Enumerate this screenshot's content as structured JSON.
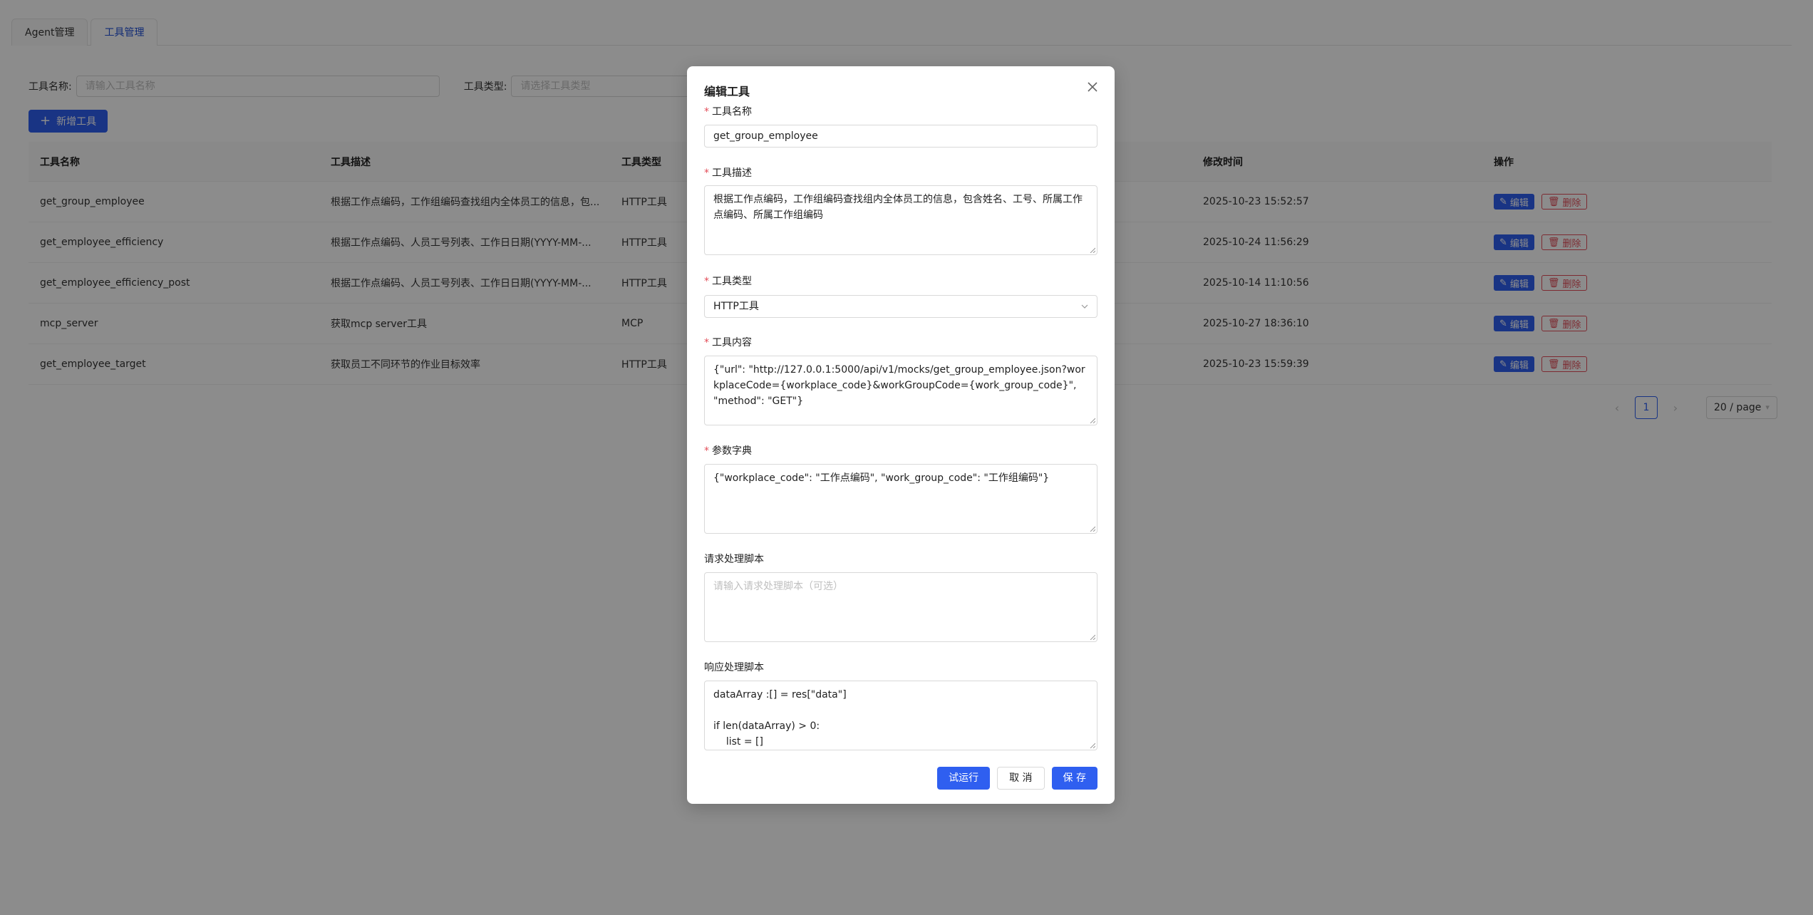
{
  "tabs": [
    {
      "label": "Agent管理",
      "active": false
    },
    {
      "label": "工具管理",
      "active": true
    }
  ],
  "filters": {
    "name_label": "工具名称:",
    "name_placeholder": "请输入工具名称",
    "type_label": "工具类型:",
    "type_placeholder": "请选择工具类型"
  },
  "add_button": {
    "label": "新增工具",
    "icon": "plus-icon"
  },
  "table": {
    "headers": {
      "name": "工具名称",
      "desc": "工具描述",
      "type": "工具类型",
      "time": "修改时间",
      "ops": "操作"
    },
    "rows": [
      {
        "name": "get_group_employee",
        "desc": "根据工作点编码，工作组编码查找组内全体员工的信息，包...",
        "type": "HTTP工具",
        "time": "2025-10-23 15:52:57"
      },
      {
        "name": "get_employee_efficiency",
        "desc": "根据工作点编码、人员工号列表、工作日日期(YYYY-MM-...",
        "type": "HTTP工具",
        "time": "2025-10-24 11:56:29"
      },
      {
        "name": "get_employee_efficiency_post",
        "desc": "根据工作点编码、人员工号列表、工作日日期(YYYY-MM-...",
        "type": "HTTP工具",
        "time": "2025-10-14 11:10:56"
      },
      {
        "name": "mcp_server",
        "desc": "获取mcp server工具",
        "type": "MCP",
        "time": "2025-10-27 18:36:10"
      },
      {
        "name": "get_employee_target",
        "desc": "获取员工不同环节的作业目标效率",
        "type": "HTTP工具",
        "time": "2025-10-23 15:59:39"
      }
    ],
    "edit_label": "编辑",
    "delete_label": "删除"
  },
  "pagination": {
    "current": "1",
    "page_size": "20 / page"
  },
  "modal": {
    "title": "编辑工具",
    "fields": {
      "name": {
        "label": "工具名称",
        "required": true,
        "value": "get_group_employee"
      },
      "desc": {
        "label": "工具描述",
        "required": true,
        "value": "根据工作点编码，工作组编码查找组内全体员工的信息，包含姓名、工号、所属工作点编码、所属工作组编码"
      },
      "type": {
        "label": "工具类型",
        "required": true,
        "value": "HTTP工具"
      },
      "content": {
        "label": "工具内容",
        "required": true,
        "value": "{\"url\": \"http://127.0.0.1:5000/api/v1/mocks/get_group_employee.json?workplaceCode={workplace_code}&workGroupCode={work_group_code}\", \"method\": \"GET\"}"
      },
      "params": {
        "label": "参数字典",
        "required": true,
        "value": "{\"workplace_code\": \"工作点编码\", \"work_group_code\": \"工作组编码\"}"
      },
      "request_script": {
        "label": "请求处理脚本",
        "required": false,
        "placeholder": "请输入请求处理脚本（可选）"
      },
      "response_script": {
        "label": "响应处理脚本",
        "required": false,
        "value": "dataArray :[] = res[\"data\"]\n\nif len(dataArray) > 0:\n    list = []"
      }
    },
    "buttons": {
      "try": "试运行",
      "cancel": "取 消",
      "save": "保 存"
    }
  },
  "colors": {
    "primary": "#2f5ff0",
    "danger": "#e34d59",
    "mask": "rgba(0,0,0,0.45)"
  }
}
